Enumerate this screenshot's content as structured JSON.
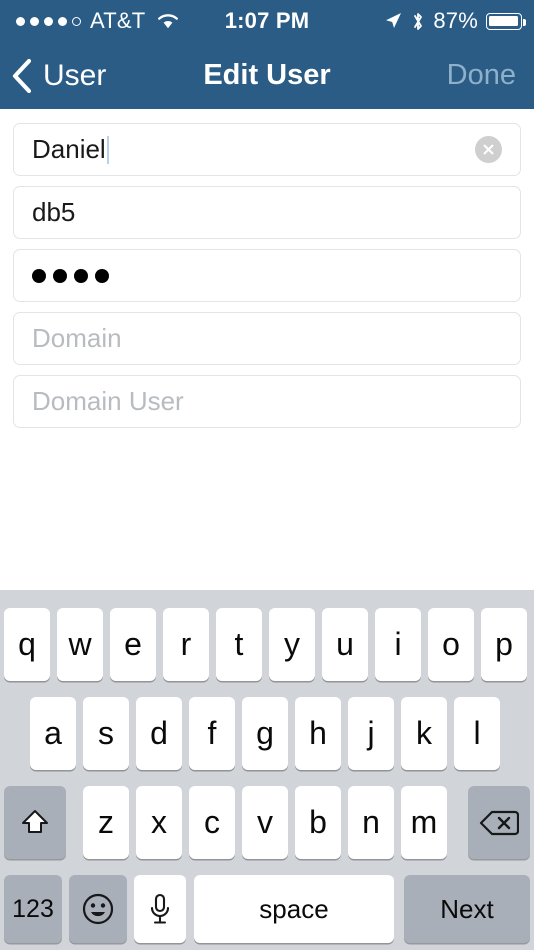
{
  "status_bar": {
    "signal_dots_total": 5,
    "signal_dots_filled": 4,
    "carrier": "AT&T",
    "wifi_icon": "wifi-icon",
    "time": "1:07 PM",
    "location_icon": "location-arrow-icon",
    "bluetooth_icon": "bluetooth-icon",
    "battery_percent": "87%",
    "battery_level": 87,
    "battery_icon": "battery-icon"
  },
  "nav_bar": {
    "back_icon": "chevron-left-icon",
    "back_label": "User",
    "title": "Edit User",
    "done_label": "Done",
    "done_enabled": false,
    "background_color": "#2a5c86",
    "done_color": "#8fb0c9"
  },
  "form": {
    "fields": [
      {
        "name": "username-field",
        "value": "Daniel",
        "placeholder": "",
        "type": "text",
        "focused": true,
        "has_clear_button": true,
        "clear_icon": "clear-circle-icon"
      },
      {
        "name": "hostname-field",
        "value": "db5",
        "placeholder": "",
        "type": "text",
        "focused": false,
        "has_clear_button": false,
        "clear_icon": ""
      },
      {
        "name": "password-field",
        "value": "••••",
        "masked_length": 4,
        "placeholder": "",
        "type": "password",
        "focused": false,
        "has_clear_button": false,
        "clear_icon": ""
      },
      {
        "name": "domain-field",
        "value": "",
        "placeholder": "Domain",
        "type": "text",
        "focused": false,
        "has_clear_button": false,
        "clear_icon": ""
      },
      {
        "name": "domain-user-field",
        "value": "",
        "placeholder": "Domain User",
        "type": "text",
        "focused": false,
        "has_clear_button": false,
        "clear_icon": ""
      }
    ]
  },
  "keyboard": {
    "background_color": "#d1d4d9",
    "key_color": "#ffffff",
    "modifier_key_color": "#a9afb8",
    "row1": [
      "q",
      "w",
      "e",
      "r",
      "t",
      "y",
      "u",
      "i",
      "o",
      "p"
    ],
    "row2": [
      "a",
      "s",
      "d",
      "f",
      "g",
      "h",
      "j",
      "k",
      "l"
    ],
    "row3_letters": [
      "z",
      "x",
      "c",
      "v",
      "b",
      "n",
      "m"
    ],
    "shift_icon": "shift-up-arrow-icon",
    "backspace_icon": "backspace-delete-icon",
    "numbers_label": "123",
    "emoji_icon": "smiley-face-icon",
    "dictation_icon": "microphone-icon",
    "space_label": "space",
    "return_label": "Next"
  }
}
